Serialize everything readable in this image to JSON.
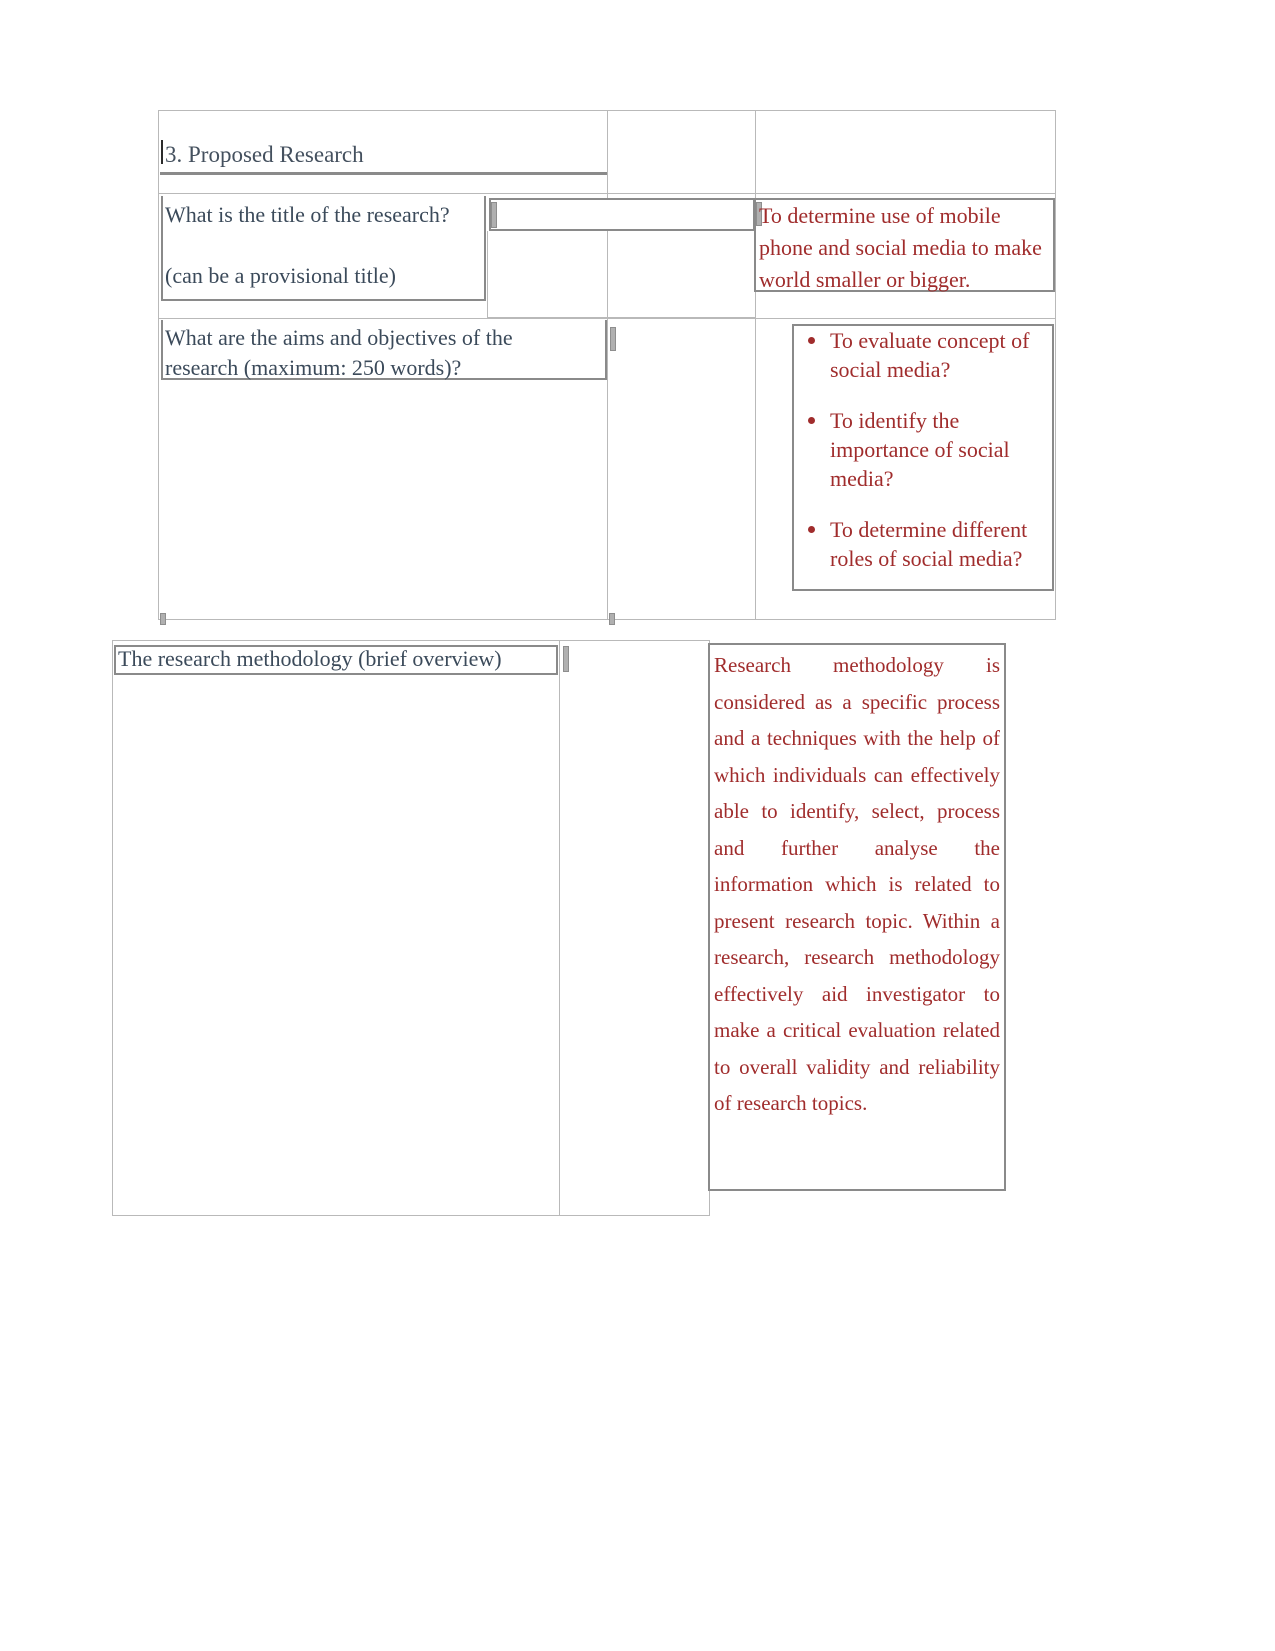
{
  "document": {
    "section_heading": "3. Proposed Research",
    "colors": {
      "question_text": "#3b4a5a",
      "answer_text": "#a02c2c",
      "grid_line": "#b9b9b9",
      "box_border": "#808080",
      "page_background": "#ffffff"
    },
    "table_one": {
      "rows": [
        {
          "question_line_1": "What is the title of the research?",
          "question_line_2": "(can be a provisional title)",
          "middle_cell": "",
          "answer": "To determine use of mobile phone and social media to make world smaller or bigger."
        },
        {
          "question_line_1": "What are the aims and objectives of the",
          "question_line_2": "research (maximum: 250 words)?",
          "middle_cell": "",
          "answer_bullets": [
            "To evaluate concept of social media?",
            "To identify the importance of social media?",
            "To determine different roles of social media?"
          ]
        }
      ]
    },
    "table_two": {
      "question": "The research methodology (brief overview)",
      "middle_cell": "",
      "answer": "Research methodology is considered as a specific process and a techniques with the help of which individuals can effectively able to identify, select, process and further analyse the information which is related to present research topic. Within a research, research methodology effectively aid investigator to make a critical evaluation related to overall validity and reliability of research topics."
    }
  }
}
